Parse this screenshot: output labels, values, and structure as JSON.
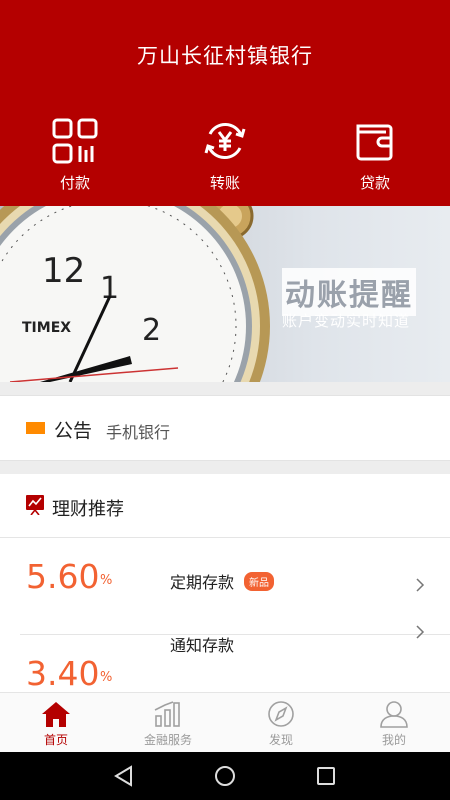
{
  "header": {
    "title": "万山长征村镇银行"
  },
  "actions": [
    {
      "label": "付款",
      "icon": "qr-code-icon"
    },
    {
      "label": "转账",
      "icon": "yuan-transfer-icon"
    },
    {
      "label": "贷款",
      "icon": "wallet-icon"
    }
  ],
  "banner": {
    "title": "动账提醒",
    "subtitle": "账户变动实时知道",
    "clock_brand": "TIMEX"
  },
  "notice": {
    "title": "公告",
    "text": "手机银行"
  },
  "products": {
    "section_title": "理财推荐",
    "items": [
      {
        "rate": "5.60",
        "unit": "%",
        "name": "定期存款",
        "badge": "新品"
      },
      {
        "rate": "3.40",
        "unit": "%",
        "name": "通知存款",
        "badge": ""
      }
    ]
  },
  "tabs": [
    {
      "label": "首页",
      "icon": "home-icon",
      "active": true
    },
    {
      "label": "金融服务",
      "icon": "bar-chart-icon",
      "active": false
    },
    {
      "label": "发现",
      "icon": "compass-icon",
      "active": false
    },
    {
      "label": "我的",
      "icon": "user-icon",
      "active": false
    }
  ],
  "colors": {
    "brand": "#b40000",
    "accent": "#f26232",
    "notice_bar": "#ff8a00"
  }
}
